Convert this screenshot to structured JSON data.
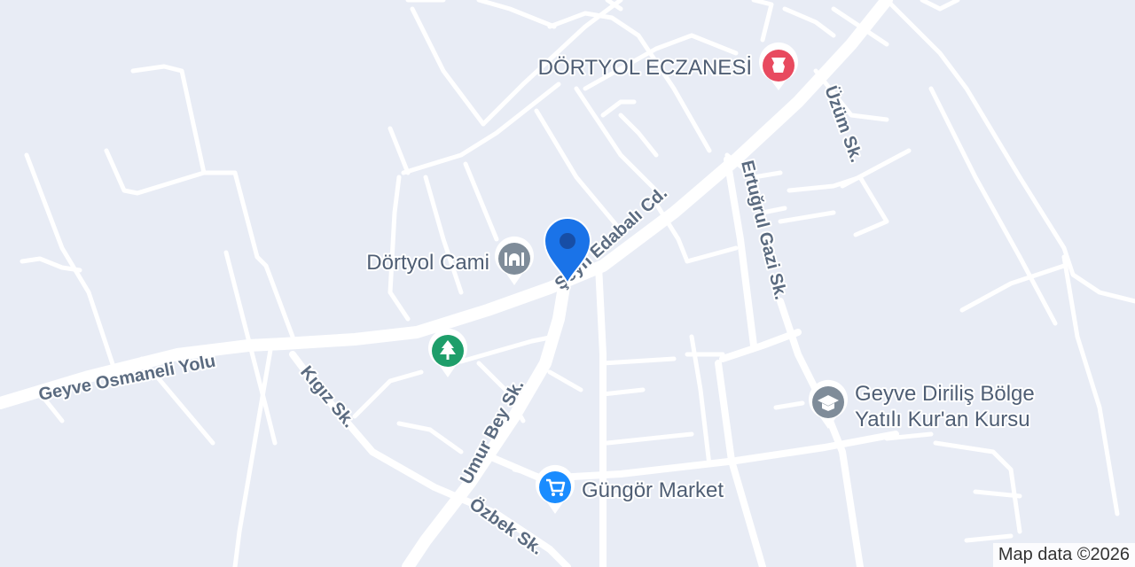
{
  "streets": {
    "geyve_osmaneli_yolu": "Geyve Osmaneli Yolu",
    "seyh_edabali_cd": "Şeyh Edabalı Cd.",
    "ertugrul_gazi_sk": "Ertuğrul Gazi Sk.",
    "uzum_sk": "Üzüm Sk.",
    "kigiz_sk": "Kıgız Sk.",
    "umur_bey_sk": "Umur Bey Sk.",
    "ozbek_sk": "Özbek Sk."
  },
  "pois": {
    "pharmacy": {
      "label": "DÖRTYOL ECZANESİ",
      "icon": "pharmacy-icon",
      "color": "#e84a5f"
    },
    "mosque": {
      "label": "Dörtyol Cami",
      "icon": "mosque-icon",
      "color": "#7f8c99"
    },
    "park": {
      "label": "",
      "icon": "tree-icon",
      "color": "#1e9e6a"
    },
    "school": {
      "label_line1": "Geyve Diriliş Bölge",
      "label_line2": "Yatılı Kur'an Kursu",
      "icon": "graduation-cap-icon",
      "color": "#7f8c99"
    },
    "market": {
      "label": "Güngör Market",
      "icon": "shopping-cart-icon",
      "color": "#1a8cff"
    }
  },
  "location_pin": {
    "icon": "location-pin-icon",
    "color": "#1a73e8"
  },
  "attribution": "Map data ©2026",
  "colors": {
    "background": "#e8ecf5",
    "road": "#ffffff",
    "label": "#5b6b80"
  }
}
